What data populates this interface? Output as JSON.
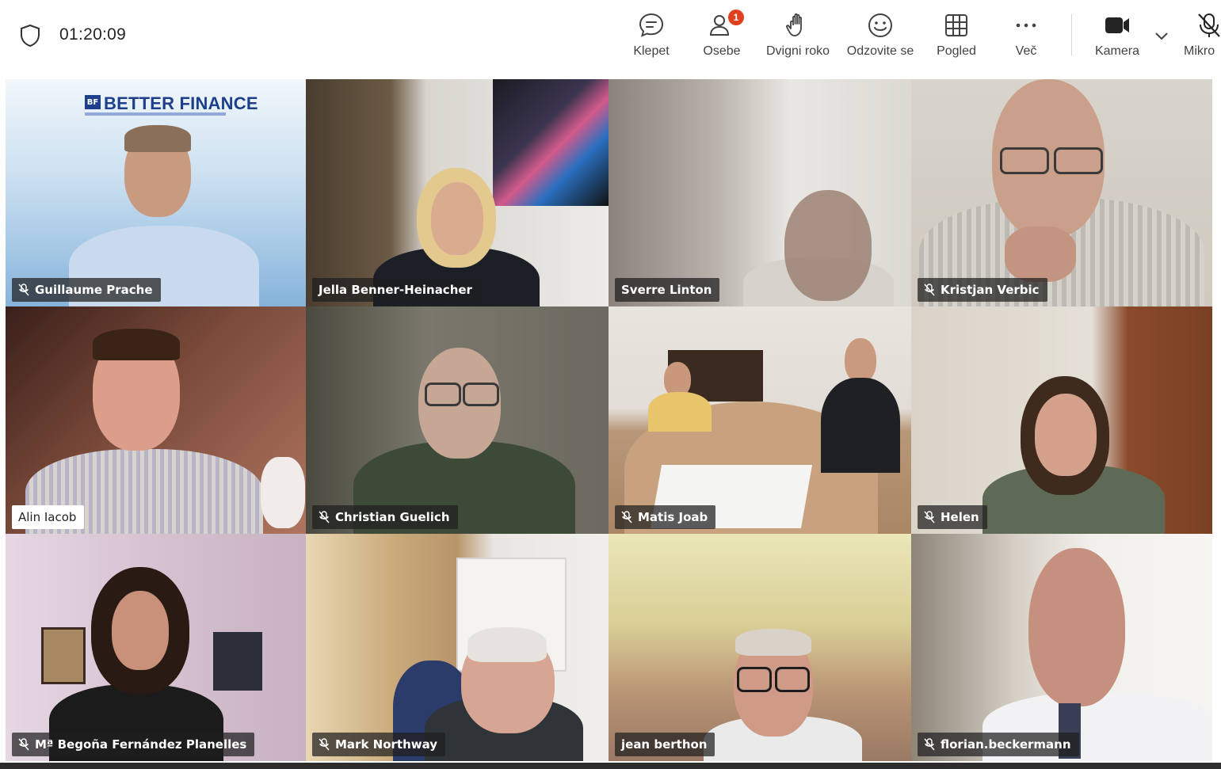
{
  "header": {
    "timer": "01:20:09",
    "toolbar": [
      {
        "label": "Klepet",
        "icon": "chat-icon"
      },
      {
        "label": "Osebe",
        "icon": "people-icon",
        "badge": "1"
      },
      {
        "label": "Dvigni roko",
        "icon": "raise-hand-icon"
      },
      {
        "label": "Odzovite se",
        "icon": "reaction-icon"
      },
      {
        "label": "Pogled",
        "icon": "grid-view-icon"
      },
      {
        "label": "Več",
        "icon": "more-icon"
      },
      {
        "label": "Kamera",
        "icon": "camera-icon"
      },
      {
        "label": "Mikro",
        "icon": "mic-off-icon"
      }
    ]
  },
  "branding": {
    "logo_text": "BETTER FINANCE",
    "logo_mark": "BF"
  },
  "participants": [
    {
      "name": "Guillaume Prache",
      "muted": true
    },
    {
      "name": "Jella Benner-Heinacher",
      "muted": false
    },
    {
      "name": "Sverre Linton",
      "muted": false
    },
    {
      "name": "Kristjan Verbic",
      "muted": true
    },
    {
      "name": "Alin Iacob",
      "muted": false
    },
    {
      "name": "Christian Guelich",
      "muted": true
    },
    {
      "name": "Matis Joab",
      "muted": true
    },
    {
      "name": "Helen",
      "muted": true
    },
    {
      "name": "Mª Begoña Fernández Planelles",
      "muted": true
    },
    {
      "name": "Mark Northway",
      "muted": true
    },
    {
      "name": "jean berthon",
      "muted": false
    },
    {
      "name": "florian.beckermann",
      "muted": true
    }
  ],
  "colors": {
    "badge": "#e0401f",
    "nametag_bg": "#1e1e1e",
    "logo_blue": "#1e3f8c"
  }
}
